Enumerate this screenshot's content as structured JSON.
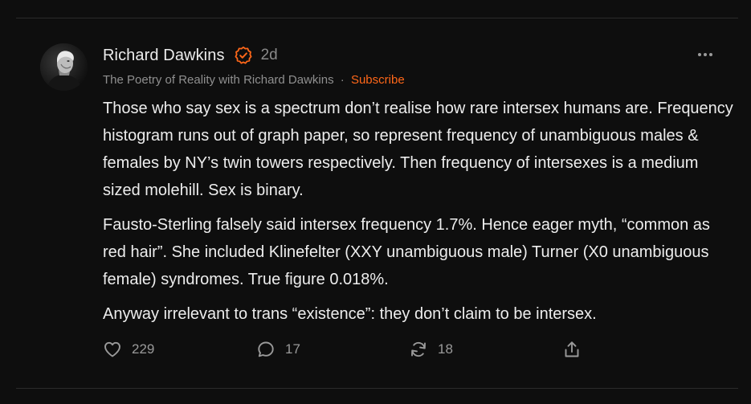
{
  "author": {
    "name": "Richard Dawkins",
    "age": "2d",
    "publication": "The Poetry of Reality with Richard Dawkins",
    "separator": "·",
    "subscribe_label": "Subscribe"
  },
  "post": {
    "paragraphs": [
      "Those who say sex is a spectrum don’t realise how rare intersex humans are. Frequency histogram runs out of graph paper, so represent frequency of unambiguous males & females by NY’s twin towers respectively. Then frequency of intersexes is a medium sized molehill. Sex is binary.",
      "Fausto-Sterling falsely said intersex frequency 1.7%. Hence eager myth, “common as red hair”. She included Klinefelter (XXY unambiguous male) Turner (X0 unambiguous female) syndromes. True figure 0.018%.",
      "Anyway irrelevant to trans “existence”: they don’t claim to be intersex."
    ]
  },
  "actions": {
    "likes": "229",
    "comments": "17",
    "restacks": "18"
  },
  "icons": {
    "verified": "verified-check-icon",
    "more": "more-dots-icon",
    "like": "heart-icon",
    "comment": "comment-bubble-icon",
    "restack": "restack-arrows-icon",
    "share": "share-icon"
  },
  "colors": {
    "background": "#0e0e0e",
    "accent": "#ff6719",
    "text": "#ededed",
    "muted": "#8f8f8f"
  }
}
